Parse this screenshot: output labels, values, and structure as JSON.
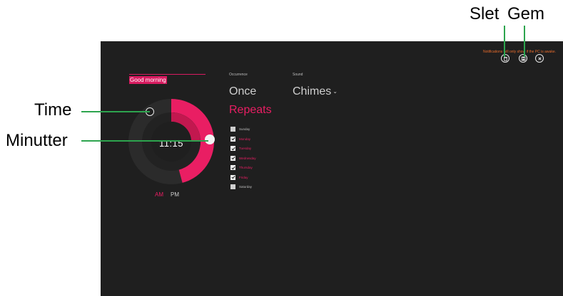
{
  "callouts": {
    "delete": "Slet",
    "save": "Gem",
    "hour": "Time",
    "minutes": "Minutter"
  },
  "alarm": {
    "notice": "Notifications will only show if the PC is awake.",
    "name": "Good morning",
    "time": "11:15",
    "hour_progress": 0.458,
    "minute_progress": 0.25,
    "am_label": "AM",
    "pm_label": "PM",
    "selected_period": "AM",
    "occurrence_heading": "Occurrence",
    "occurrence_once": "Once",
    "occurrence_repeats": "Repeats",
    "sound_heading": "Sound",
    "sound_value": "Chimes",
    "days": [
      {
        "label": "Sunday",
        "checked": false
      },
      {
        "label": "Monday",
        "checked": true
      },
      {
        "label": "Tuesday",
        "checked": true
      },
      {
        "label": "Wednesday",
        "checked": true
      },
      {
        "label": "Thursday",
        "checked": true
      },
      {
        "label": "Friday",
        "checked": true
      },
      {
        "label": "Saturday",
        "checked": false
      }
    ],
    "buttons": {
      "delete_icon": "trash-icon",
      "save_icon": "floppy-icon",
      "close_icon": "close-icon"
    }
  },
  "colors": {
    "accent": "#e91e63",
    "accent_dark": "#b0103f",
    "background": "#1f1f1f",
    "leader": "#2da44e"
  }
}
